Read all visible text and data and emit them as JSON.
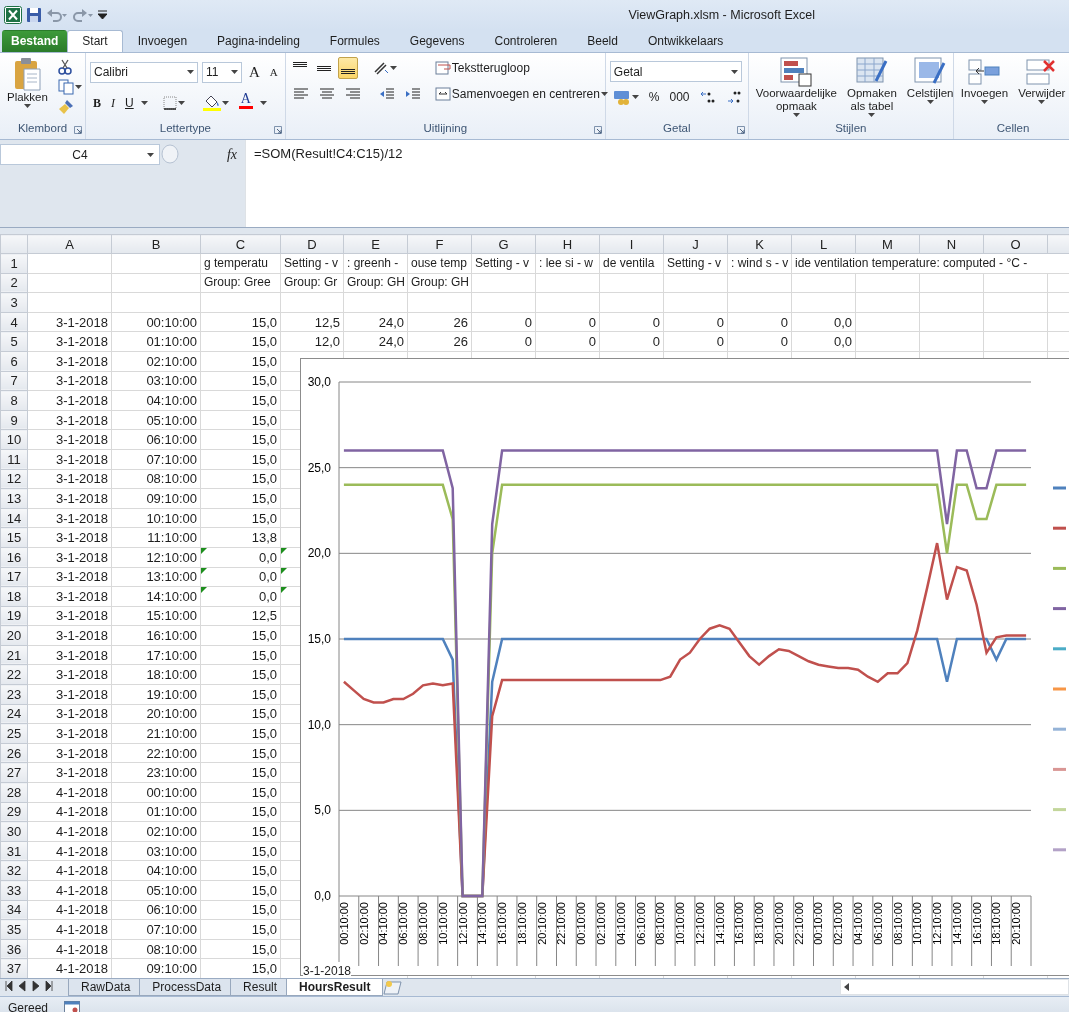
{
  "window": {
    "title": "ViewGraph.xlsm  -  Microsoft Excel"
  },
  "ribbon_tabs": [
    {
      "label": "Bestand",
      "kind": "file",
      "selected": false
    },
    {
      "label": "Start",
      "kind": "tab",
      "selected": true
    },
    {
      "label": "Invoegen",
      "kind": "tab",
      "selected": false
    },
    {
      "label": "Pagina-indeling",
      "kind": "tab",
      "selected": false
    },
    {
      "label": "Formules",
      "kind": "tab",
      "selected": false
    },
    {
      "label": "Gegevens",
      "kind": "tab",
      "selected": false
    },
    {
      "label": "Controleren",
      "kind": "tab",
      "selected": false
    },
    {
      "label": "Beeld",
      "kind": "tab",
      "selected": false
    },
    {
      "label": "Ontwikkelaars",
      "kind": "tab",
      "selected": false
    }
  ],
  "ribbon": {
    "clipboard": {
      "paste": "Plakken",
      "group": "Klembord"
    },
    "font": {
      "name": "Calibri",
      "size": "11",
      "grow": "A",
      "shrink": "A",
      "bold": "B",
      "italic": "I",
      "underline": "U",
      "font_color_button": "A",
      "group": "Lettertype"
    },
    "alignment": {
      "vertical": [
        {
          "kind": "top",
          "selected": false
        },
        {
          "kind": "middle",
          "selected": false
        },
        {
          "kind": "bottom",
          "selected": true
        }
      ],
      "wrap": "Tekstterugloop",
      "merge": "Samenvoegen en centreren",
      "group": "Uitlijning"
    },
    "number": {
      "format": "Getal",
      "percent": "%",
      "thousands": "000",
      "group": "Getal"
    },
    "styles": {
      "buttons": [
        {
          "kind": "conditional",
          "lines": [
            "Voorwaardelijke",
            "opmaak"
          ]
        },
        {
          "kind": "table",
          "lines": [
            "Opmaken",
            "als tabel"
          ]
        },
        {
          "kind": "cellstyles",
          "lines": [
            "Celstijlen"
          ]
        }
      ],
      "group": "Stijlen"
    },
    "cells": {
      "buttons": [
        {
          "kind": "insert",
          "lines": [
            "Invoegen"
          ]
        },
        {
          "kind": "delete",
          "lines": [
            "Verwijder"
          ]
        }
      ],
      "group": "Cellen"
    }
  },
  "formula_bar": {
    "name_box": "C4",
    "fx": "fx",
    "formula": "=SOM(Result!C4:C15)/12"
  },
  "sheet": {
    "columns": [
      "A",
      "B",
      "C",
      "D",
      "E",
      "F",
      "G",
      "H",
      "I",
      "J",
      "K",
      "L",
      "M",
      "N",
      "O"
    ],
    "title_rows": [
      {
        "number": "1",
        "cells": [
          "g temperatu",
          "Setting - v",
          ": greenh -",
          "ouse temp",
          "Setting - v",
          ": lee si - w",
          "de ventila",
          "Setting - v",
          ": wind s - v",
          "ide ventilation temperature: computed - °C -"
        ]
      },
      {
        "number": "2",
        "cells": [
          "Group: Gree",
          "Group: Gr",
          "Group: GH",
          "Group: GH"
        ]
      },
      {
        "number": "3",
        "cells": []
      }
    ],
    "rows": [
      {
        "number": "4",
        "error_mark": false,
        "cells": [
          "3-1-2018",
          "00:10:00",
          "15,0",
          "12,5",
          "24,0",
          "26",
          "0",
          "0",
          "0",
          "0",
          "0",
          "0,0"
        ]
      },
      {
        "number": "5",
        "error_mark": false,
        "cells": [
          "3-1-2018",
          "01:10:00",
          "15,0",
          "12,0",
          "24,0",
          "26",
          "0",
          "0",
          "0",
          "0",
          "0",
          "0,0"
        ]
      },
      {
        "number": "6",
        "error_mark": false,
        "cells": [
          "3-1-2018",
          "02:10:00",
          "15,0"
        ]
      },
      {
        "number": "7",
        "error_mark": false,
        "cells": [
          "3-1-2018",
          "03:10:00",
          "15,0"
        ]
      },
      {
        "number": "8",
        "error_mark": false,
        "cells": [
          "3-1-2018",
          "04:10:00",
          "15,0"
        ]
      },
      {
        "number": "9",
        "error_mark": false,
        "cells": [
          "3-1-2018",
          "05:10:00",
          "15,0"
        ]
      },
      {
        "number": "10",
        "error_mark": false,
        "cells": [
          "3-1-2018",
          "06:10:00",
          "15,0"
        ]
      },
      {
        "number": "11",
        "error_mark": false,
        "cells": [
          "3-1-2018",
          "07:10:00",
          "15,0"
        ]
      },
      {
        "number": "12",
        "error_mark": false,
        "cells": [
          "3-1-2018",
          "08:10:00",
          "15,0"
        ]
      },
      {
        "number": "13",
        "error_mark": false,
        "cells": [
          "3-1-2018",
          "09:10:00",
          "15,0"
        ]
      },
      {
        "number": "14",
        "error_mark": false,
        "cells": [
          "3-1-2018",
          "10:10:00",
          "15,0"
        ]
      },
      {
        "number": "15",
        "error_mark": false,
        "cells": [
          "3-1-2018",
          "11:10:00",
          "13,8"
        ]
      },
      {
        "number": "16",
        "error_mark": true,
        "cells": [
          "3-1-2018",
          "12:10:00",
          "0,0"
        ]
      },
      {
        "number": "17",
        "error_mark": true,
        "cells": [
          "3-1-2018",
          "13:10:00",
          "0,0"
        ]
      },
      {
        "number": "18",
        "error_mark": true,
        "cells": [
          "3-1-2018",
          "14:10:00",
          "0,0"
        ]
      },
      {
        "number": "19",
        "error_mark": false,
        "cells": [
          "3-1-2018",
          "15:10:00",
          "12,5"
        ]
      },
      {
        "number": "20",
        "error_mark": false,
        "cells": [
          "3-1-2018",
          "16:10:00",
          "15,0"
        ]
      },
      {
        "number": "21",
        "error_mark": false,
        "cells": [
          "3-1-2018",
          "17:10:00",
          "15,0"
        ]
      },
      {
        "number": "22",
        "error_mark": false,
        "cells": [
          "3-1-2018",
          "18:10:00",
          "15,0"
        ]
      },
      {
        "number": "23",
        "error_mark": false,
        "cells": [
          "3-1-2018",
          "19:10:00",
          "15,0"
        ]
      },
      {
        "number": "24",
        "error_mark": false,
        "cells": [
          "3-1-2018",
          "20:10:00",
          "15,0"
        ]
      },
      {
        "number": "25",
        "error_mark": false,
        "cells": [
          "3-1-2018",
          "21:10:00",
          "15,0"
        ]
      },
      {
        "number": "26",
        "error_mark": false,
        "cells": [
          "3-1-2018",
          "22:10:00",
          "15,0"
        ]
      },
      {
        "number": "27",
        "error_mark": false,
        "cells": [
          "3-1-2018",
          "23:10:00",
          "15,0"
        ]
      },
      {
        "number": "28",
        "error_mark": false,
        "cells": [
          "4-1-2018",
          "00:10:00",
          "15,0"
        ]
      },
      {
        "number": "29",
        "error_mark": false,
        "cells": [
          "4-1-2018",
          "01:10:00",
          "15,0"
        ]
      },
      {
        "number": "30",
        "error_mark": false,
        "cells": [
          "4-1-2018",
          "02:10:00",
          "15,0"
        ]
      },
      {
        "number": "31",
        "error_mark": false,
        "cells": [
          "4-1-2018",
          "03:10:00",
          "15,0"
        ]
      },
      {
        "number": "32",
        "error_mark": false,
        "cells": [
          "4-1-2018",
          "04:10:00",
          "15,0"
        ]
      },
      {
        "number": "33",
        "error_mark": false,
        "cells": [
          "4-1-2018",
          "05:10:00",
          "15,0"
        ]
      },
      {
        "number": "34",
        "error_mark": false,
        "cells": [
          "4-1-2018",
          "06:10:00",
          "15,0"
        ]
      },
      {
        "number": "35",
        "error_mark": false,
        "cells": [
          "4-1-2018",
          "07:10:00",
          "15,0"
        ]
      },
      {
        "number": "36",
        "error_mark": false,
        "cells": [
          "4-1-2018",
          "08:10:00",
          "15,0"
        ]
      },
      {
        "number": "37",
        "error_mark": false,
        "cells": [
          "4-1-2018",
          "09:10:00",
          "15,0"
        ]
      }
    ]
  },
  "chart": {
    "date_label": "3-1-2018",
    "legend": [
      {
        "color": "#4f81bd"
      },
      {
        "color": "#c0504d"
      },
      {
        "color": "#9bbb59"
      },
      {
        "color": "#8064a2"
      },
      {
        "color": "#4bacc6"
      },
      {
        "color": "#f79646"
      },
      {
        "color": "#95b3d7"
      },
      {
        "color": "#d99694"
      },
      {
        "color": "#c3d69b"
      },
      {
        "color": "#b3a2c7"
      }
    ],
    "chart_data": {
      "type": "line",
      "ylim": [
        0,
        30
      ],
      "grid": true,
      "yticks": [
        {
          "value": 0,
          "label": "0,0"
        },
        {
          "value": 5,
          "label": "5,0"
        },
        {
          "value": 10,
          "label": "10,0"
        },
        {
          "value": 15,
          "label": "15,0"
        },
        {
          "value": 20,
          "label": "20,0"
        },
        {
          "value": 25,
          "label": "25,0"
        },
        {
          "value": 30,
          "label": "30,0"
        }
      ],
      "categories": [
        "00:10:00",
        null,
        "02:10:00",
        null,
        "04:10:00",
        null,
        "06:10:00",
        null,
        "08:10:00",
        null,
        "10:10:00",
        null,
        "12:10:00",
        null,
        "14:10:00",
        null,
        "16:10:00",
        null,
        "18:10:00",
        null,
        "20:10:00",
        null,
        "22:10:00",
        null,
        "00:10:00",
        null,
        "02:10:00",
        null,
        "04:10:00",
        null,
        "06:10:00",
        null,
        "08:10:00",
        null,
        "10:10:00",
        null,
        "12:10:00",
        null,
        "14:10:00",
        null,
        "16:10:00",
        null,
        "18:10:00",
        null,
        "20:10:00",
        null,
        "22:10:00",
        null,
        "00:10:00",
        null,
        "02:10:00",
        null,
        "04:10:00",
        null,
        "06:10:00",
        null,
        "08:10:00",
        null,
        "10:10:00",
        null,
        "12:10:00",
        null,
        "14:10:00",
        null,
        "16:10:00",
        null,
        "18:10:00",
        null,
        "20:10:00",
        null
      ],
      "series": [
        {
          "color": "#4f81bd",
          "values": [
            15,
            15,
            15,
            15,
            15,
            15,
            15,
            15,
            15,
            15,
            15,
            13.8,
            0,
            0,
            0,
            12.5,
            15,
            15,
            15,
            15,
            15,
            15,
            15,
            15,
            15,
            15,
            15,
            15,
            15,
            15,
            15,
            15,
            15,
            15,
            15,
            15,
            15,
            15,
            15,
            15,
            15,
            15,
            15,
            15,
            15,
            15,
            15,
            15,
            15,
            15,
            15,
            15,
            15,
            15,
            15,
            15,
            15,
            15,
            15,
            15,
            15,
            12.5,
            15,
            15,
            15,
            15,
            13.8,
            15,
            15,
            15
          ]
        },
        {
          "color": "#c0504d",
          "values": [
            12.5,
            12,
            11.5,
            11.3,
            11.3,
            11.5,
            11.5,
            11.8,
            12.3,
            12.4,
            12.3,
            12.4,
            0,
            0,
            0,
            10.5,
            12.6,
            12.6,
            12.6,
            12.6,
            12.6,
            12.6,
            12.6,
            12.6,
            12.6,
            12.6,
            12.6,
            12.6,
            12.6,
            12.6,
            12.6,
            12.6,
            12.6,
            12.8,
            13.8,
            14.2,
            15,
            15.6,
            15.8,
            15.6,
            14.8,
            14,
            13.5,
            14,
            14.4,
            14.3,
            14,
            13.7,
            13.5,
            13.4,
            13.3,
            13.3,
            13.2,
            12.8,
            12.5,
            13,
            13,
            13.6,
            15.5,
            18,
            20.6,
            17.3,
            19.2,
            19,
            17,
            14.2,
            15.1,
            15.2,
            15.2,
            15.2
          ]
        },
        {
          "color": "#9bbb59",
          "values": [
            24,
            24,
            24,
            24,
            24,
            24,
            24,
            24,
            24,
            24,
            24,
            22,
            0,
            0,
            0,
            20,
            24,
            24,
            24,
            24,
            24,
            24,
            24,
            24,
            24,
            24,
            24,
            24,
            24,
            24,
            24,
            24,
            24,
            24,
            24,
            24,
            24,
            24,
            24,
            24,
            24,
            24,
            24,
            24,
            24,
            24,
            24,
            24,
            24,
            24,
            24,
            24,
            24,
            24,
            24,
            24,
            24,
            24,
            24,
            24,
            24,
            20,
            24,
            24,
            22,
            22,
            24,
            24,
            24,
            24
          ]
        },
        {
          "color": "#8064a2",
          "values": [
            26,
            26,
            26,
            26,
            26,
            26,
            26,
            26,
            26,
            26,
            26,
            23.8,
            0,
            0,
            0,
            21.7,
            26,
            26,
            26,
            26,
            26,
            26,
            26,
            26,
            26,
            26,
            26,
            26,
            26,
            26,
            26,
            26,
            26,
            26,
            26,
            26,
            26,
            26,
            26,
            26,
            26,
            26,
            26,
            26,
            26,
            26,
            26,
            26,
            26,
            26,
            26,
            26,
            26,
            26,
            26,
            26,
            26,
            26,
            26,
            26,
            26,
            21.7,
            26,
            26,
            23.8,
            23.8,
            26,
            26,
            26,
            26
          ]
        }
      ]
    }
  },
  "sheet_tabs": [
    {
      "label": "RawData",
      "selected": false
    },
    {
      "label": "ProcessData",
      "selected": false
    },
    {
      "label": "Result",
      "selected": false
    },
    {
      "label": "HoursResult",
      "selected": true
    }
  ],
  "status_bar": {
    "text": "Gereed"
  }
}
